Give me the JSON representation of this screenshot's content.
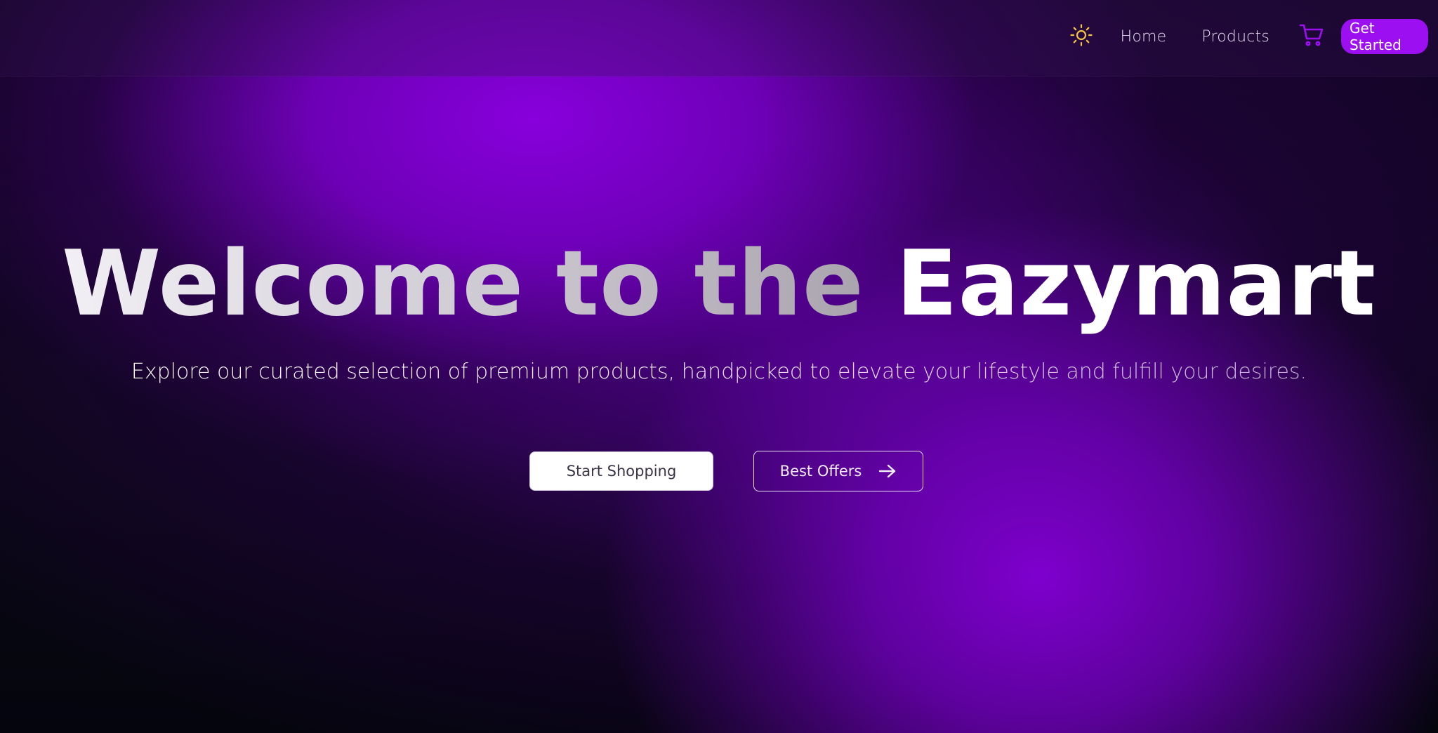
{
  "header": {
    "theme_icon": "sun-icon",
    "nav": {
      "home_label": "Home",
      "products_label": "Products"
    },
    "cart_icon": "cart-icon",
    "cta_label": "Get Started"
  },
  "hero": {
    "title_part1": "Welcome to the",
    "title_part2": "Eazymart",
    "subtitle": "Explore our curated selection of premium products, handpicked to elevate your lifestyle and fulfill your desires.",
    "primary_button_label": "Start Shopping",
    "secondary_button_label": "Best Offers",
    "secondary_button_icon": "arrow-right-icon"
  },
  "colors": {
    "accent": "#9b0ff0",
    "sun": "#f5c542",
    "background_dark": "#05060f",
    "glow_purple": "#8400d6"
  }
}
